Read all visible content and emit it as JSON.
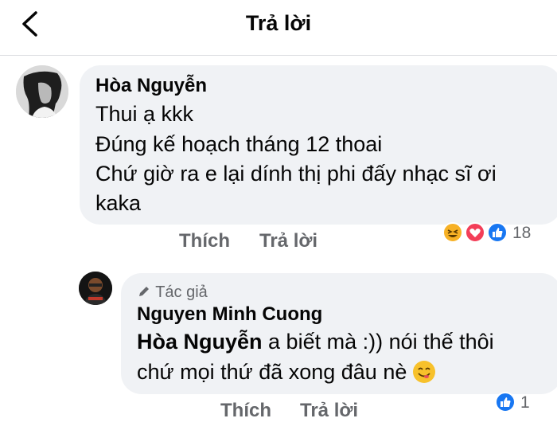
{
  "header": {
    "title": "Trả lời"
  },
  "comment": {
    "author": "Hòa Nguyễn",
    "lines": [
      "Thui ạ kkk",
      "Đúng kế hoạch tháng 12 thoai",
      "Chứ giờ ra e lại dính thị phi đấy nhạc sĩ ơi",
      "kaka"
    ],
    "like_label": "Thích",
    "reply_label": "Trả lời",
    "reactions": [
      "haha",
      "love",
      "like"
    ],
    "reaction_count": "18",
    "colors": {
      "haha": "#f7b125",
      "love": "#f33e58",
      "like": "#1877f2"
    }
  },
  "reply": {
    "badge": "Tác giả",
    "author": "Nguyen Minh Cuong",
    "mention": "Hòa Nguyễn",
    "line1_rest": " a biết mà :)) nói thế thôi",
    "line2": "chứ mọi thứ đã xong đâu nè",
    "emoji": "😋",
    "like_label": "Thích",
    "reply_label": "Trả lời",
    "reactions": [
      "like"
    ],
    "reaction_count": "1"
  }
}
